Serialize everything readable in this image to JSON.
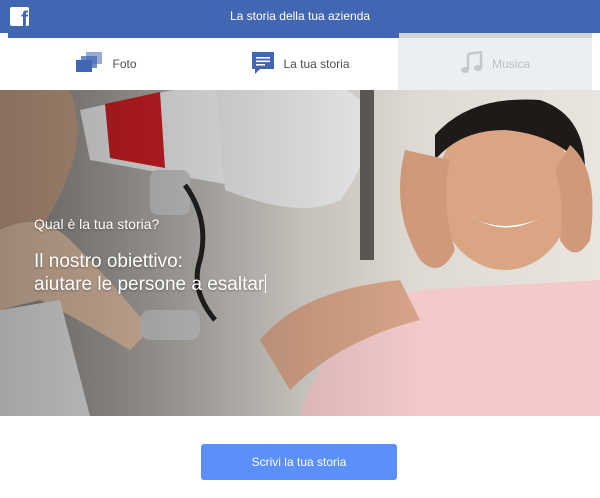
{
  "header": {
    "title": "La storia della tua azienda",
    "logo_icon": "facebook-logo-icon",
    "logo_glyph": "f"
  },
  "progress": {
    "fraction": 0.67
  },
  "tabs": [
    {
      "label": "Foto",
      "icon": "photos-icon",
      "state": "default"
    },
    {
      "label": "La tua storia",
      "icon": "chat-bubble-icon",
      "state": "active"
    },
    {
      "label": "Musica",
      "icon": "music-note-icon",
      "state": "disabled"
    }
  ],
  "hero": {
    "prompt": "Qual è la tua storia?",
    "story_line1": "Il nostro obiettivo:",
    "story_line2": "aiutare le persone a esaltar"
  },
  "cta": {
    "label": "Scrivi la tua storia"
  },
  "colors": {
    "brand": "#4267b2",
    "button": "#5b8ff9",
    "tab_disabled_bg": "#eceff2"
  }
}
